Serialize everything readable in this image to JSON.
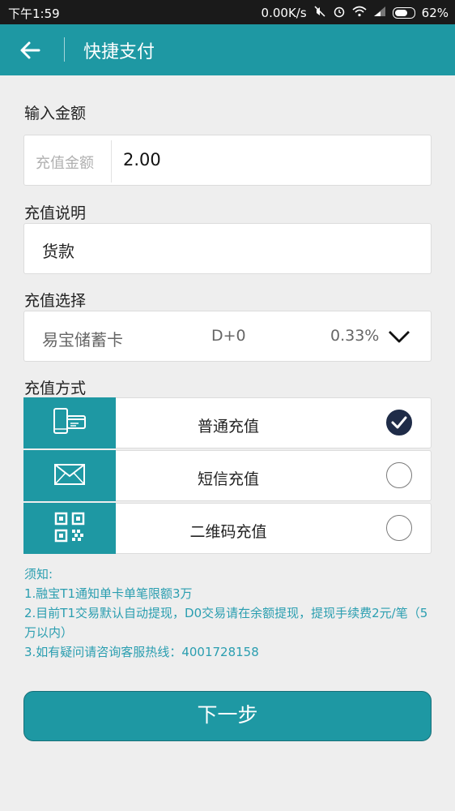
{
  "status_bar": {
    "time": "下午1:59",
    "speed": "0.00K/s",
    "battery": "62%"
  },
  "app_bar": {
    "title": "快捷支付",
    "back_icon": "arrow-left-icon"
  },
  "amount_section": {
    "label": "输入金额",
    "field_label": "充值金额",
    "value": "2.00"
  },
  "description_section": {
    "label": "充值说明",
    "value": "货款"
  },
  "selection_section": {
    "label": "充值选择",
    "bank": "易宝储蓄卡",
    "settlement": "D+0",
    "rate": "0.33%",
    "dropdown_icon": "chevron-down-icon"
  },
  "method_section": {
    "label": "充值方式",
    "methods": [
      {
        "label": "普通充值",
        "icon": "card-phone-icon",
        "checked": true
      },
      {
        "label": "短信充值",
        "icon": "envelope-icon",
        "checked": false
      },
      {
        "label": "二维码充值",
        "icon": "qr-code-icon",
        "checked": false
      }
    ]
  },
  "notes": {
    "heading": "须知:",
    "items": [
      "1.融宝T1通知单卡单笔限额3万",
      "2.目前T1交易默认自动提现，D0交易请在余额提现，提现手续费2元/笔（5万以内）",
      "3.如有疑问请咨询客服热线：4001728158"
    ]
  },
  "next_button": "下一步",
  "colors": {
    "primary": "#1e98a3",
    "note_text": "#2a9eb0",
    "checked": "#1f2c48"
  }
}
